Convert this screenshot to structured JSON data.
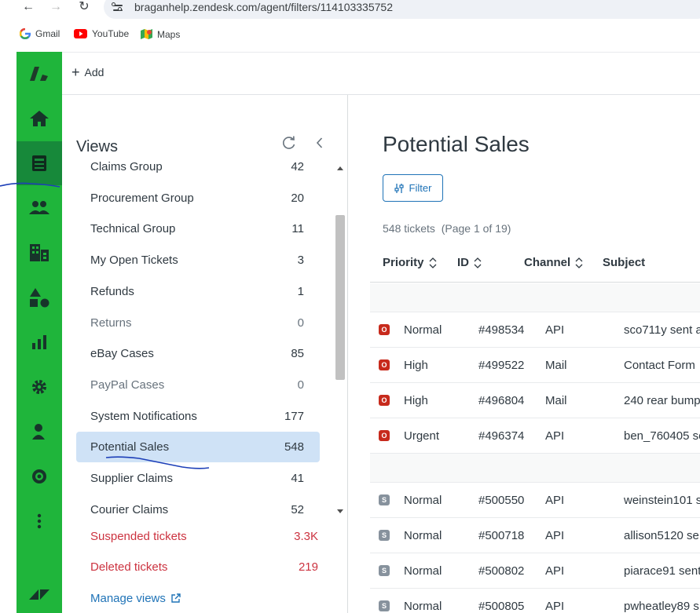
{
  "browser": {
    "url": "braganhelp.zendesk.com/agent/filters/114103335752",
    "bookmarks": [
      "Gmail",
      "YouTube",
      "Maps"
    ]
  },
  "leftnav": {
    "items": [
      "logo",
      "home",
      "views",
      "customers",
      "organizations",
      "objects",
      "reporting",
      "admin",
      "user",
      "mailchimp",
      "more",
      "zendesk-products"
    ],
    "active": "views",
    "brand_color": "#1fb53b",
    "active_color": "#17893a"
  },
  "topbar": {
    "add_label": "Add"
  },
  "views": {
    "title": "Views",
    "items": [
      {
        "label": "Claims Group",
        "count": "42",
        "muted": false
      },
      {
        "label": "Procurement Group",
        "count": "20",
        "muted": false
      },
      {
        "label": "Technical Group",
        "count": "11",
        "muted": false
      },
      {
        "label": "My Open Tickets",
        "count": "3",
        "muted": false
      },
      {
        "label": "Refunds",
        "count": "1",
        "muted": false
      },
      {
        "label": "Returns",
        "count": "0",
        "muted": true
      },
      {
        "label": "eBay Cases",
        "count": "85",
        "muted": false
      },
      {
        "label": "PayPal Cases",
        "count": "0",
        "muted": true
      },
      {
        "label": "System Notifications",
        "count": "177",
        "muted": false
      },
      {
        "label": "Potential Sales",
        "count": "548",
        "muted": false,
        "selected": true
      },
      {
        "label": "Supplier Claims",
        "count": "41",
        "muted": false
      },
      {
        "label": "Courier Claims",
        "count": "52",
        "muted": false
      }
    ],
    "suspended": {
      "label": "Suspended tickets",
      "count": "3.3K"
    },
    "deleted": {
      "label": "Deleted tickets",
      "count": "219"
    },
    "manage_label": "Manage views"
  },
  "main": {
    "title": "Potential Sales",
    "filter_label": "Filter",
    "ticket_count": "548 tickets",
    "page_info": "(Page 1 of 19)",
    "columns": [
      "Priority",
      "ID",
      "Channel",
      "Subject"
    ],
    "rows": [
      {
        "status": "O",
        "priority": "Normal",
        "id": "#498534",
        "channel": "API",
        "subject": "sco711y sent a"
      },
      {
        "status": "O",
        "priority": "High",
        "id": "#499522",
        "channel": "Mail",
        "subject": "Contact Form"
      },
      {
        "status": "O",
        "priority": "High",
        "id": "#496804",
        "channel": "Mail",
        "subject": "240 rear bump"
      },
      {
        "status": "O",
        "priority": "Urgent",
        "id": "#496374",
        "channel": "API",
        "subject": "ben_760405 se"
      },
      {
        "status": "S",
        "priority": "Normal",
        "id": "#500550",
        "channel": "API",
        "subject": "weinstein101 s"
      },
      {
        "status": "S",
        "priority": "Normal",
        "id": "#500718",
        "channel": "API",
        "subject": "allison5120 se"
      },
      {
        "status": "S",
        "priority": "Normal",
        "id": "#500802",
        "channel": "API",
        "subject": "piarace91 sent"
      },
      {
        "status": "S",
        "priority": "Normal",
        "id": "#500805",
        "channel": "API",
        "subject": "pwheatley89 s"
      }
    ],
    "status_colors": {
      "open": "#c72a1c",
      "solved": "#87929d"
    }
  }
}
